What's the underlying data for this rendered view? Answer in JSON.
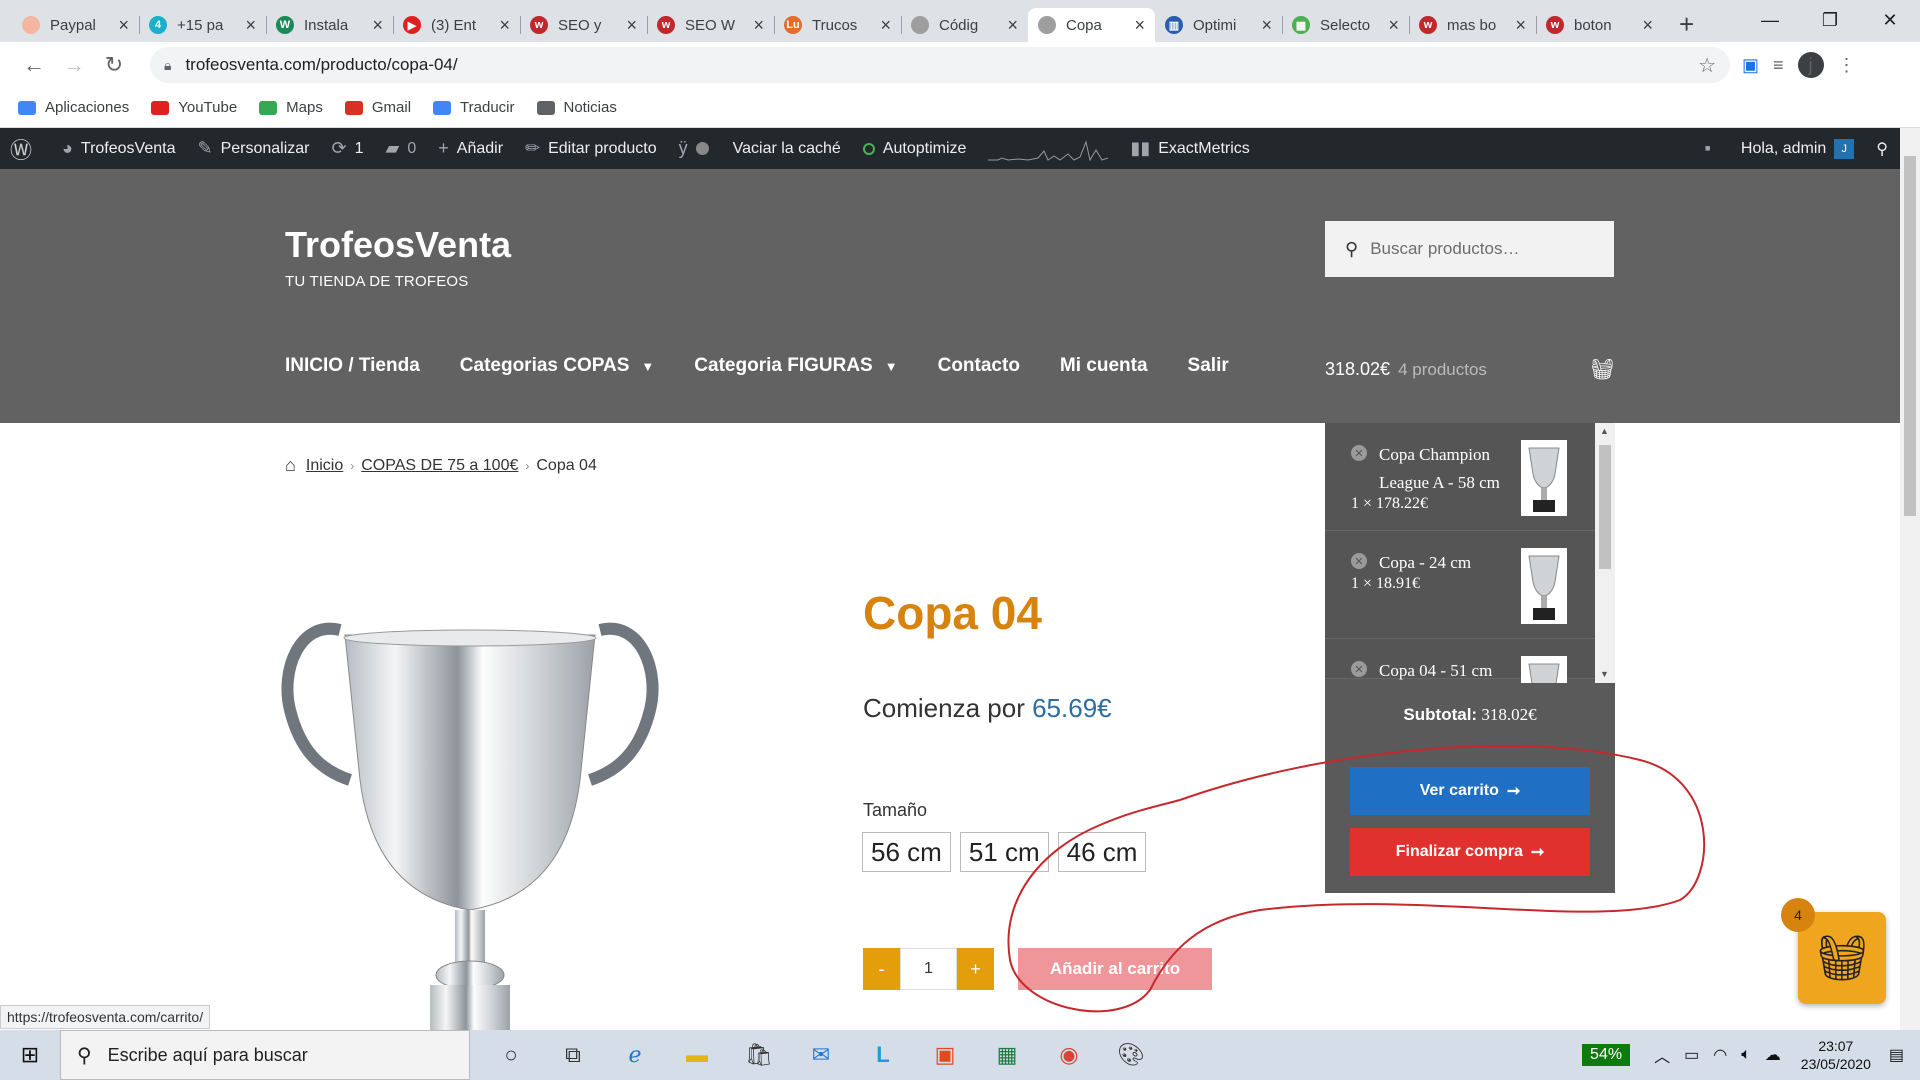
{
  "browser": {
    "tabs": [
      {
        "title": "Paypal",
        "color": "#f4b6a2",
        "glyph": ""
      },
      {
        "title": "+15 pa",
        "color": "#1ab0c9",
        "glyph": "4"
      },
      {
        "title": "Instala",
        "color": "#1b8a5a",
        "glyph": "W"
      },
      {
        "title": "(3) Ent",
        "color": "#e02020",
        "glyph": "▶"
      },
      {
        "title": "SEO y",
        "color": "#c1272d",
        "glyph": "w"
      },
      {
        "title": "SEO W",
        "color": "#c1272d",
        "glyph": "w"
      },
      {
        "title": "Trucos",
        "color": "#e26d2c",
        "glyph": "Lu"
      },
      {
        "title": "Códig",
        "color": "#9e9e9e",
        "glyph": ""
      },
      {
        "title": "Copa",
        "color": "#9e9e9e",
        "glyph": ""
      },
      {
        "title": "Optimi",
        "color": "#2a5db0",
        "glyph": "▥"
      },
      {
        "title": "Selecto",
        "color": "#4caf50",
        "glyph": "▦"
      },
      {
        "title": "mas bo",
        "color": "#c1272d",
        "glyph": "w"
      },
      {
        "title": "boton",
        "color": "#c1272d",
        "glyph": "w"
      }
    ],
    "active_tab_index": 8,
    "url": "trofeosventa.com/producto/copa-04/",
    "profile_initial": "j",
    "status_url": "https://trofeosventa.com/carrito/"
  },
  "bookmarks": [
    {
      "label": "Aplicaciones",
      "color": "#4285f4"
    },
    {
      "label": "YouTube",
      "color": "#e02020"
    },
    {
      "label": "Maps",
      "color": "#34a853"
    },
    {
      "label": "Gmail",
      "color": "#d93025"
    },
    {
      "label": "Traducir",
      "color": "#4285f4"
    },
    {
      "label": "Noticias",
      "color": "#5f6368"
    }
  ],
  "adminbar": {
    "site": "TrofeosVenta",
    "customize": "Personalizar",
    "updates": "1",
    "comments": "0",
    "add": "Añadir",
    "edit": "Editar producto",
    "clear_cache": "Vaciar la caché",
    "autoptimize": "Autoptimize",
    "exactmetrics": "ExactMetrics",
    "greeting": "Hola, admin",
    "avatar_initial": "J"
  },
  "header": {
    "title": "TrofeosVenta",
    "tagline": "TU TIENDA DE TROFEOS",
    "search_placeholder": "Buscar productos…",
    "menu": [
      "INICIO / Tienda",
      "Categorias COPAS",
      "Categoria FIGURAS",
      "Contacto",
      "Mi cuenta",
      "Salir"
    ],
    "cart_total": "318.02€",
    "cart_count": "4 productos"
  },
  "breadcrumb": {
    "home": "Inicio",
    "category": "COPAS DE 75 a 100€",
    "current": "Copa 04"
  },
  "product": {
    "title": "Copa 04",
    "price_prefix": "Comienza por",
    "price": "65.69€",
    "size_label": "Tamaño",
    "sizes": [
      "56 cm",
      "51 cm",
      "46 cm"
    ],
    "qty": "1",
    "qty_minus": "-",
    "qty_plus": "+",
    "add_to_cart": "Añadir al carrito"
  },
  "minicart": {
    "items": [
      {
        "name": "Copa Champion League A - 58 cm",
        "qty": "1 × 178.22€"
      },
      {
        "name": "Copa - 24 cm",
        "qty": "1 × 18.91€"
      },
      {
        "name": "Copa 04 - 51 cm",
        "qty": ""
      }
    ],
    "subtotal_label": "Subtotal:",
    "subtotal": "318.02€",
    "view_cart": "Ver carrito",
    "checkout": "Finalizar compra"
  },
  "floating_cart": {
    "count": "4"
  },
  "taskbar": {
    "search_placeholder": "Escribe aquí para buscar",
    "battery": "54%",
    "time": "23:07",
    "date": "23/05/2020"
  },
  "colors": {
    "accent_orange": "#d68310",
    "view_cart_blue": "#1f6fc5",
    "checkout_red": "#e0312e",
    "annotation_red": "#c6282b"
  }
}
